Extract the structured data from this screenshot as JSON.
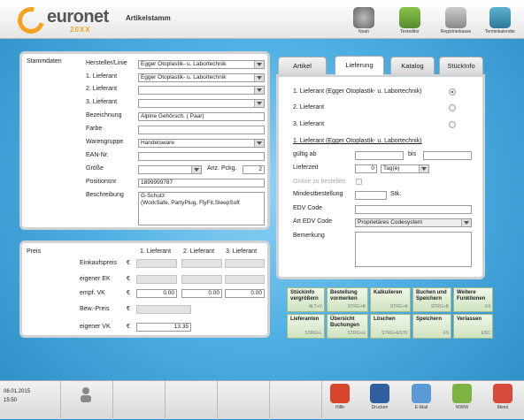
{
  "header": {
    "title": "Artikelstamm",
    "logo_text": "euronet",
    "logo_sub": "20XX",
    "toolbar": [
      {
        "label": "Noah",
        "color": "#7a7a7a"
      },
      {
        "label": "Texteditor",
        "color": "#6aa84f"
      },
      {
        "label": "Registrierkasse",
        "color": "#9a9a9a"
      },
      {
        "label": "Terminkalender",
        "color": "#3a8fb0"
      }
    ]
  },
  "left": {
    "section_title": "Stammdaten",
    "fields": {
      "hersteller_label": "Hersteller/Linie",
      "hersteller_value": "Egger Otoplastik- u. Labortechnik",
      "lief1_label": "1. Lieferant",
      "lief1_value": "Egger Otoplastik- u. Labortechnik",
      "lief2_label": "2. Lieferant",
      "lief2_value": "",
      "lief3_label": "3. Lieferant",
      "lief3_value": "",
      "bezeichnung_label": "Bezeichnung",
      "bezeichnung_value": "Alpine Gehörsch. ( Paar)",
      "farbe_label": "Farbe",
      "farbe_value": "",
      "warengruppe_label": "Warengruppe",
      "warengruppe_value": "Handelsware",
      "ean_label": "EAN-Nr.",
      "ean_value": "",
      "groesse_label": "Größe",
      "groesse_value": "",
      "anz_label": "Anz. Pckg.",
      "anz_value": "2",
      "position_label": "Positionsnr",
      "position_value": "1899999787",
      "beschreibung_label": "Beschreibung",
      "beschreibung_line1": "G-Schutz",
      "beschreibung_line2": "(WorkSafe, PartyPlug, FlyFit,SleepSoft"
    }
  },
  "preis": {
    "section_title": "Preis",
    "col1": "1. Lieferant",
    "col2": "2. Lieferant",
    "col3": "3. Lieferant",
    "currency": "€",
    "einkauf_label": "Einkaufspreis",
    "eigener_ek_label": "eigener EK",
    "empf_vk_label": "empf. VK",
    "empf_vk_values": [
      "0.00",
      "0.00",
      "0.00"
    ],
    "bew_label": "Bew.-Preis",
    "eigener_vk_label": "eigener VK",
    "eigener_vk_value": "13.35"
  },
  "tabs": [
    "Artikel",
    "Lieferung",
    "Katalog",
    "StückInfo"
  ],
  "lieferung": {
    "radio1": "1. Lieferant (Egger Otoplastik- u. Labortechnik)",
    "radio2": "2. Lieferant",
    "radio3": "3. Lieferant",
    "selected_heading": "1. Lieferant (Egger Otoplastik- u. Labortechnik)",
    "gueltig_label": "gültig ab",
    "bis_label": "bis",
    "lieferzeit_label": "Lieferzeit",
    "lieferzeit_value": "0",
    "lieferzeit_unit": "Tag(e)",
    "online_label": "Online zu bestellen",
    "mindest_label": "Mindestbestellung",
    "mindest_unit": "Stk.",
    "edv_label": "EDV Code",
    "art_edv_label": "Art EDV Code",
    "art_edv_value": "Proprietäres Codesystem",
    "bemerkung_label": "Bemerkung"
  },
  "actions": [
    {
      "label": "Stückinfo vergrößern",
      "shortcut": "ALT+V"
    },
    {
      "label": "Bestellung vormerken",
      "shortcut": "STRG+B"
    },
    {
      "label": "Kalkulieren",
      "shortcut": "STRG+K"
    },
    {
      "label": "Buchen und Speichern",
      "shortcut": "STRG+B"
    },
    {
      "label": "Weitere Funktionen",
      "shortcut": "F4"
    },
    {
      "label": "Lieferanten",
      "shortcut": "STRG+L"
    },
    {
      "label": "Übersicht Buchungen",
      "shortcut": "STRG+U"
    },
    {
      "label": "Löschen",
      "shortcut": "STRG+ENTF"
    },
    {
      "label": "Speichern",
      "shortcut": "F5"
    },
    {
      "label": "Verlassen",
      "shortcut": "ESC"
    }
  ],
  "footer": {
    "date": "06.01.2015",
    "time": "15:50",
    "buttons": [
      {
        "label": "Hilfe",
        "color": "#d9452b"
      },
      {
        "label": "Drucken",
        "color": "#2f5f9e"
      },
      {
        "label": "E-Mail",
        "color": "#5a9bd5"
      },
      {
        "label": "WWW",
        "color": "#7cb342"
      },
      {
        "label": "Menü",
        "color": "#d84a3a"
      }
    ]
  }
}
